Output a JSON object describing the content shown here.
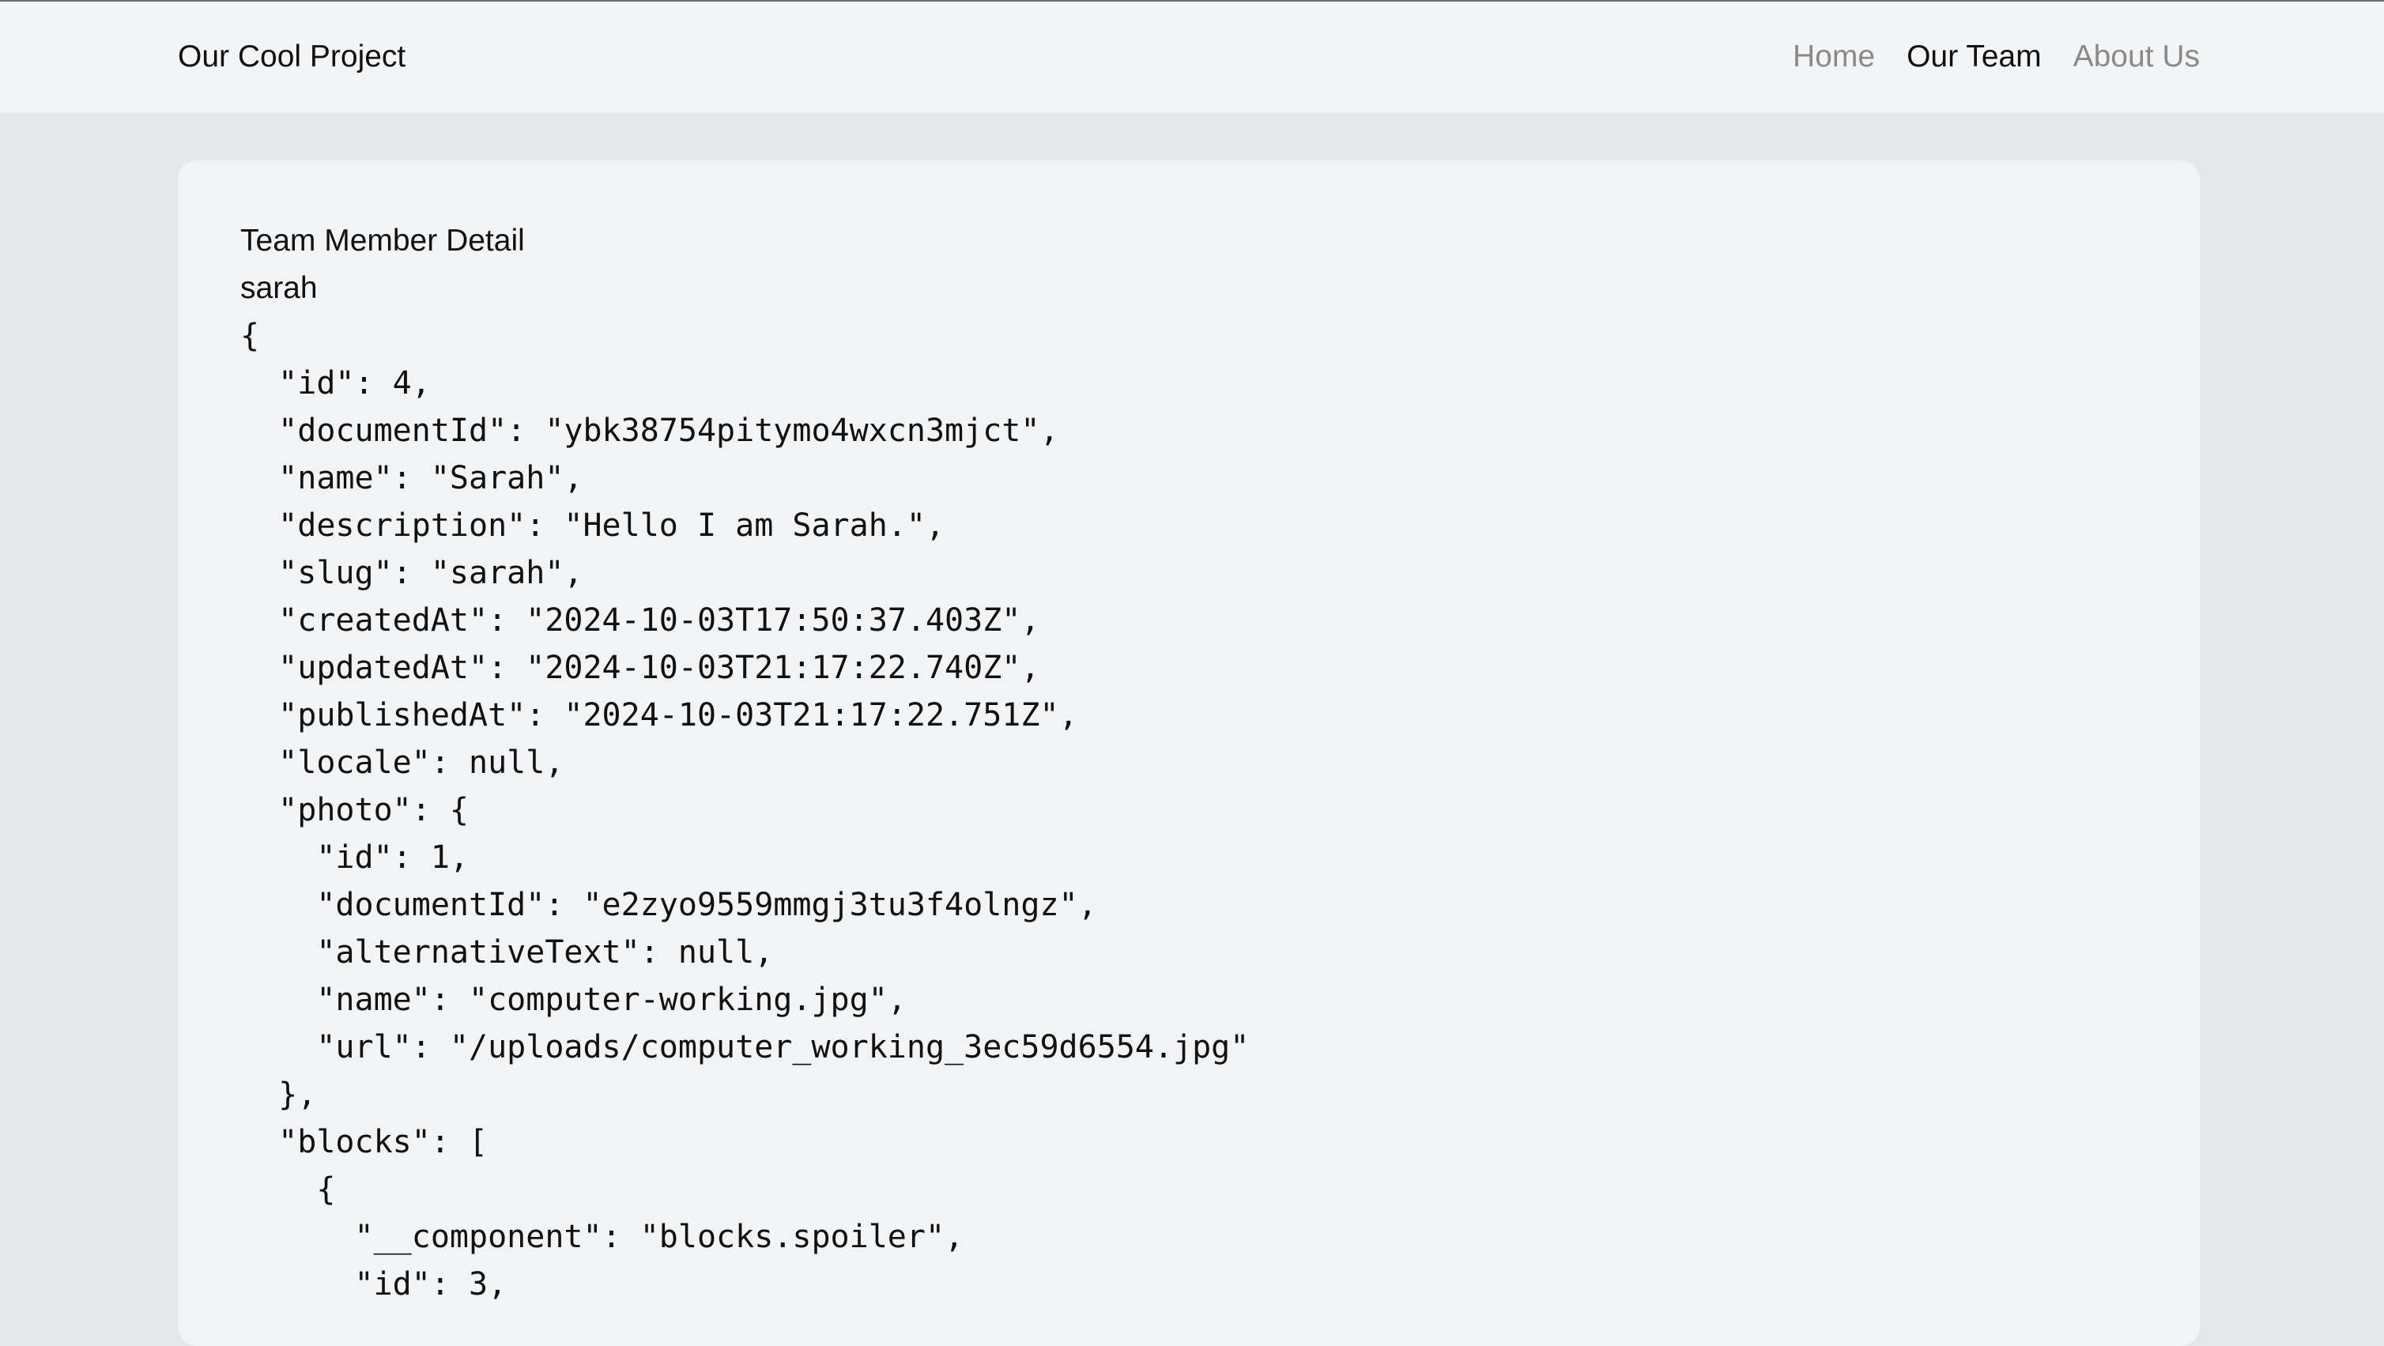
{
  "header": {
    "brand": "Our Cool Project",
    "nav": [
      {
        "label": "Home",
        "active": false
      },
      {
        "label": "Our Team",
        "active": true
      },
      {
        "label": "About Us",
        "active": false
      }
    ]
  },
  "main": {
    "title": "Team Member Detail",
    "slug": "sarah",
    "json_text": "{\n  \"id\": 4,\n  \"documentId\": \"ybk38754pitymo4wxcn3mjct\",\n  \"name\": \"Sarah\",\n  \"description\": \"Hello I am Sarah.\",\n  \"slug\": \"sarah\",\n  \"createdAt\": \"2024-10-03T17:50:37.403Z\",\n  \"updatedAt\": \"2024-10-03T21:17:22.740Z\",\n  \"publishedAt\": \"2024-10-03T21:17:22.751Z\",\n  \"locale\": null,\n  \"photo\": {\n    \"id\": 1,\n    \"documentId\": \"e2zyo9559mmgj3tu3f4olngz\",\n    \"alternativeText\": null,\n    \"name\": \"computer-working.jpg\",\n    \"url\": \"/uploads/computer_working_3ec59d6554.jpg\"\n  },\n  \"blocks\": [\n    {\n      \"__component\": \"blocks.spoiler\",\n      \"id\": 3,"
  }
}
